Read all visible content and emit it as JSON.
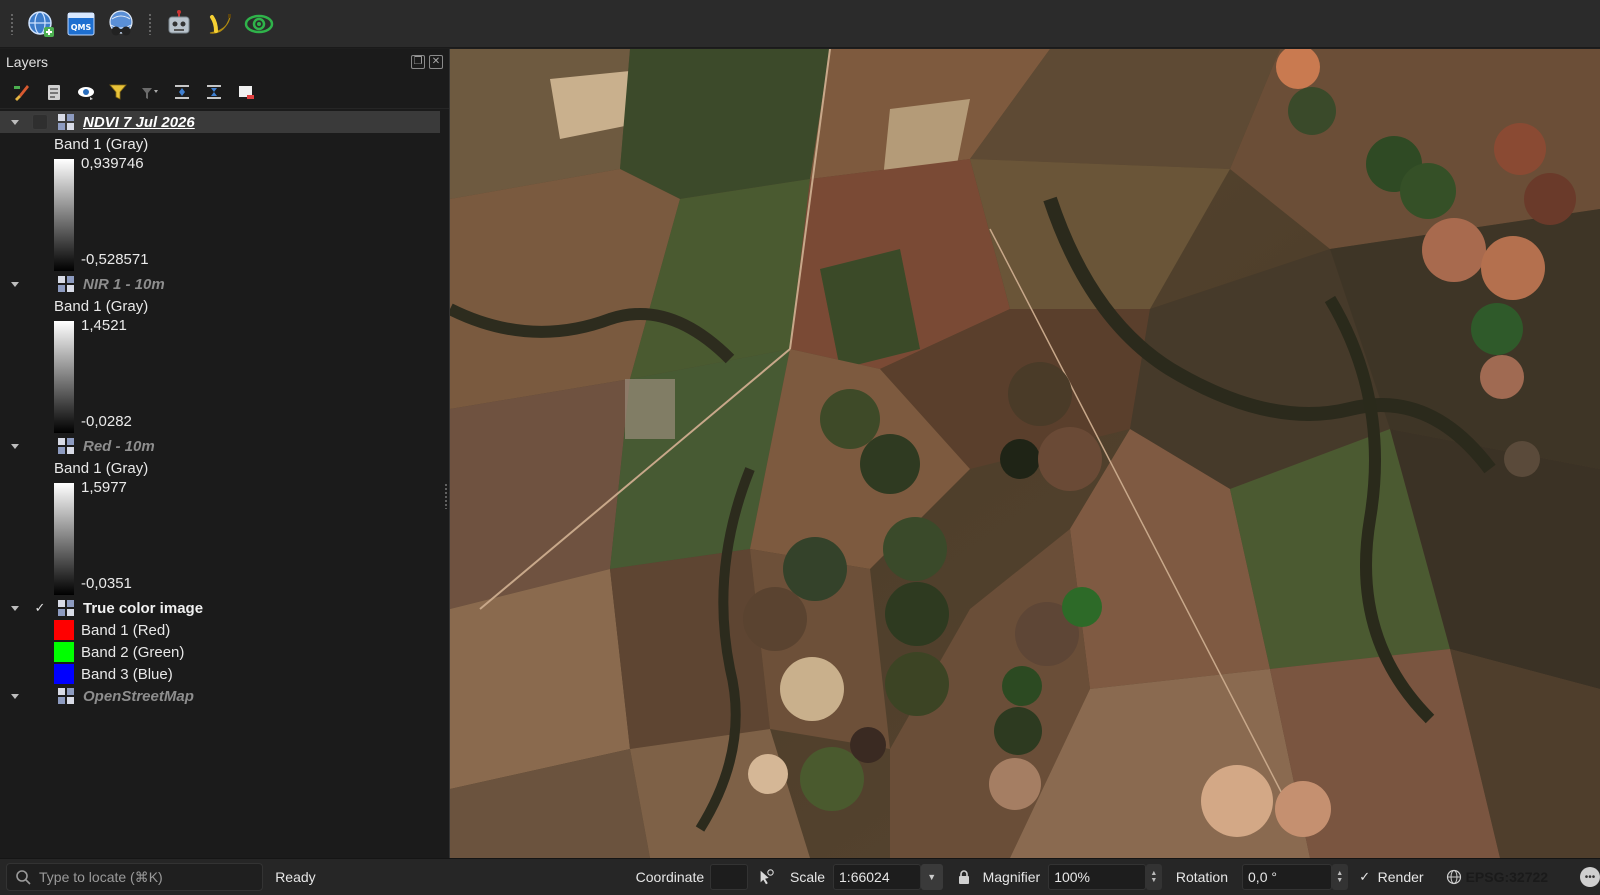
{
  "toolbar": {
    "buttons": [
      {
        "icon": "globe-add-icon"
      },
      {
        "icon": "qms-icon",
        "badge": "QMS"
      },
      {
        "icon": "globe-binoculars-icon"
      },
      {
        "icon": "robot-icon"
      },
      {
        "icon": "banana-icon"
      },
      {
        "icon": "eye-swirl-icon"
      }
    ]
  },
  "layers_panel": {
    "title": "Layers",
    "layers": [
      {
        "name": "NDVI 7 Jul 2026",
        "checked": false,
        "selected": true,
        "band_label": "Band 1 (Gray)",
        "max": "0,939746",
        "min": "-0,528571"
      },
      {
        "name": "NIR 1 - 10m",
        "checked": false,
        "band_label": "Band 1 (Gray)",
        "max": "1,4521",
        "min": "-0,0282"
      },
      {
        "name": "Red - 10m",
        "checked": false,
        "band_label": "Band 1 (Gray)",
        "max": "1,5977",
        "min": "-0,0351"
      },
      {
        "name": "True color image",
        "checked": true,
        "bands": [
          {
            "label": "Band 1 (Red)",
            "color": "#ff0000"
          },
          {
            "label": "Band 2 (Green)",
            "color": "#00ff00"
          },
          {
            "label": "Band 3 (Blue)",
            "color": "#0000ff"
          }
        ]
      },
      {
        "name": "OpenStreetMap",
        "checked": false
      }
    ]
  },
  "status_bar": {
    "locator_placeholder": "Type to locate (⌘K)",
    "ready": "Ready",
    "coordinate_label": "Coordinate",
    "coordinate_value": "",
    "scale_label": "Scale",
    "scale_value": "1:66024",
    "magnifier_label": "Magnifier",
    "magnifier_value": "100%",
    "rotation_label": "Rotation",
    "rotation_value": "0,0 °",
    "render_label": "Render",
    "render_checked": true,
    "crs": "EPSG:32722"
  },
  "colors": {
    "panel_bg": "#1b1b1b",
    "toolbar_bg": "#2b2b2b",
    "selection_bg": "#3a3a3a"
  }
}
